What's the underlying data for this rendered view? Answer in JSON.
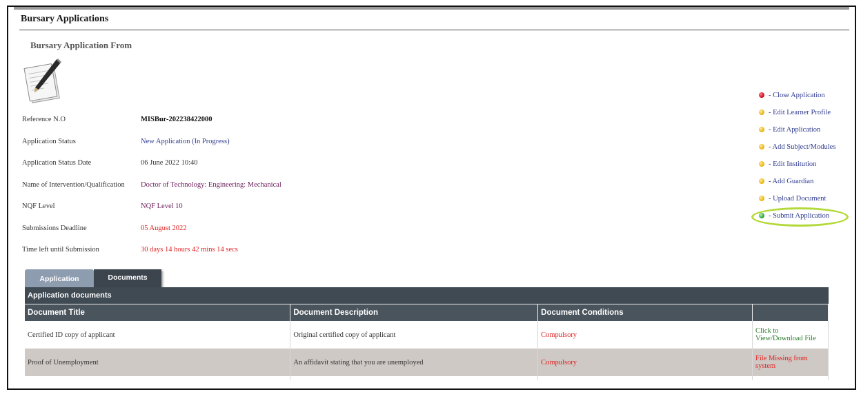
{
  "header": {
    "title": "Bursary Applications",
    "subtitle": "Bursary Application From"
  },
  "icons": {
    "document": "document-pencil-icon"
  },
  "info": [
    {
      "label": "Reference N.O",
      "value": "MISBur-202238422000",
      "style": "bold"
    },
    {
      "label": "Application Status",
      "value": "New Application (In Progress)",
      "style": "blue"
    },
    {
      "label": "Application Status Date",
      "value": "06 June 2022 10:40",
      "style": "dark"
    },
    {
      "label": "Name of Intervention/Qualification",
      "value": "Doctor of Technology: Engineering: Mechanical",
      "style": "purple"
    },
    {
      "label": "NQF Level",
      "value": "NQF Level 10",
      "style": "purple"
    },
    {
      "label": "Submissions Deadline",
      "value": "05 August 2022",
      "style": "red"
    },
    {
      "label": "Time left until Submission",
      "value": "30 days 14 hours 42 mins 14 secs",
      "style": "red"
    }
  ],
  "actions": [
    {
      "label": "- Close Application",
      "status": "red"
    },
    {
      "label": "- Edit Learner Profile",
      "status": "yellow"
    },
    {
      "label": "- Edit Application",
      "status": "yellow"
    },
    {
      "label": "- Add Subject/Modules",
      "status": "yellow"
    },
    {
      "label": "- Edit Institution",
      "status": "yellow"
    },
    {
      "label": "- Add Guardian",
      "status": "yellow"
    },
    {
      "label": "- Upload Document",
      "status": "yellow"
    },
    {
      "label": "- Submit Application",
      "status": "green"
    }
  ],
  "tabs": {
    "application": "Application",
    "documents": "Documents"
  },
  "documents": {
    "section_title": "Application documents",
    "columns": [
      "Document Title",
      "Document Description",
      "Document Conditions",
      ""
    ],
    "rows": [
      {
        "title": "Certified ID copy of applicant",
        "description": "Original certified copy of applicant",
        "condition": "Compulsory",
        "file": "Click to View/Download File",
        "file_state": "available"
      },
      {
        "title": "Proof of Unemployment",
        "description": "An affidavit stating that you are unemployed",
        "condition": "Compulsory",
        "file": "File Missing from system",
        "file_state": "missing"
      }
    ]
  },
  "colors": {
    "status_red": "#e02020",
    "status_yellow": "#e8b000",
    "status_green": "#1e9a2e",
    "highlight": "#b4d93a",
    "table_header": "#4a545c",
    "link_blue": "#2f3b8f"
  }
}
